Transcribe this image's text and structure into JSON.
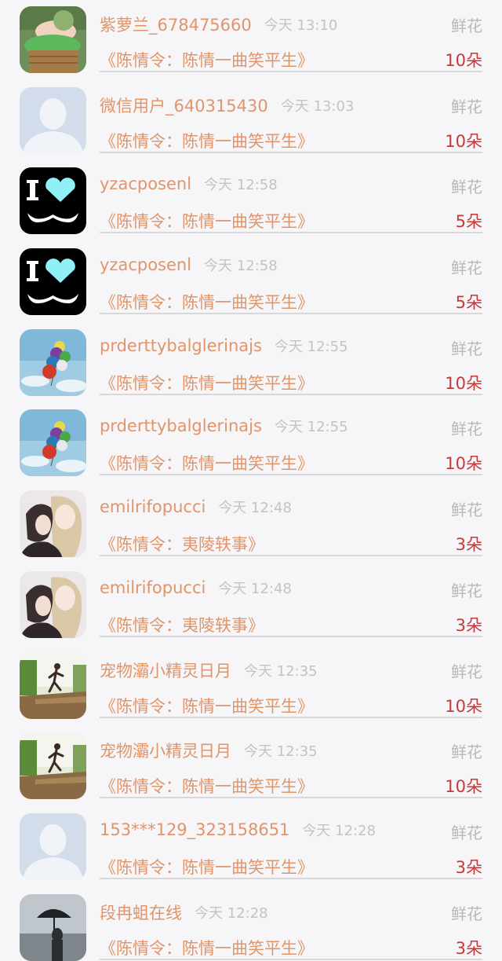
{
  "rows": [
    {
      "name": "紫萝兰_678475660",
      "time": "今天 13:10",
      "gift": "鲜花",
      "work": "《陈情令：陈情一曲笑平生》",
      "qty": "10朵",
      "avatar": "baby-photo"
    },
    {
      "name": "微信用户_640315430",
      "time": "今天 13:03",
      "gift": "鲜花",
      "work": "《陈情令：陈情一曲笑平生》",
      "qty": "10朵",
      "avatar": "default-user"
    },
    {
      "name": "yzacposenl",
      "time": "今天 12:58",
      "gift": "鲜花",
      "work": "《陈情令：陈情一曲笑平生》",
      "qty": "5朵",
      "avatar": "heart-mustache"
    },
    {
      "name": "yzacposenl",
      "time": "今天 12:58",
      "gift": "鲜花",
      "work": "《陈情令：陈情一曲笑平生》",
      "qty": "5朵",
      "avatar": "heart-mustache"
    },
    {
      "name": "prderttybalglerinajs",
      "time": "今天 12:55",
      "gift": "鲜花",
      "work": "《陈情令：陈情一曲笑平生》",
      "qty": "10朵",
      "avatar": "balloons"
    },
    {
      "name": "prderttybalglerinajs",
      "time": "今天 12:55",
      "gift": "鲜花",
      "work": "《陈情令：陈情一曲笑平生》",
      "qty": "10朵",
      "avatar": "balloons"
    },
    {
      "name": "emilrifopucci",
      "time": "今天 12:48",
      "gift": "鲜花",
      "work": "《陈情令：夷陵轶事》",
      "qty": "3朵",
      "avatar": "anime-couple"
    },
    {
      "name": "emilrifopucci",
      "time": "今天 12:48",
      "gift": "鲜花",
      "work": "《陈情令：夷陵轶事》",
      "qty": "3朵",
      "avatar": "anime-couple"
    },
    {
      "name": "宠物灞小精灵日月",
      "time": "今天 12:35",
      "gift": "鲜花",
      "work": "《陈情令：陈情一曲笑平生》",
      "qty": "10朵",
      "avatar": "runner"
    },
    {
      "name": "宠物灞小精灵日月",
      "time": "今天 12:35",
      "gift": "鲜花",
      "work": "《陈情令：陈情一曲笑平生》",
      "qty": "10朵",
      "avatar": "runner"
    },
    {
      "name": "153***129_323158651",
      "time": "今天 12:28",
      "gift": "鲜花",
      "work": "《陈情令：陈情一曲笑平生》",
      "qty": "3朵",
      "avatar": "default-user"
    },
    {
      "name": "段冉蛆在线",
      "time": "今天 12:28",
      "gift": "鲜花",
      "work": "《陈情令：陈情一曲笑平生》",
      "qty": "3朵",
      "avatar": "umbrella-rain"
    }
  ]
}
